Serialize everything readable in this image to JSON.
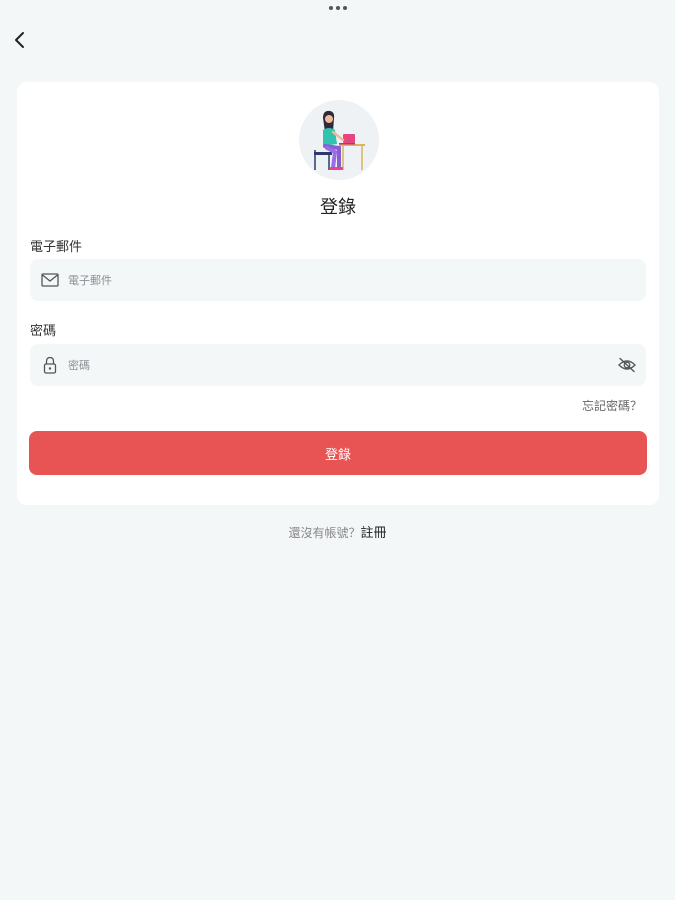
{
  "header": {
    "back_icon": "chevron-left-icon"
  },
  "login_card": {
    "title": "登錄",
    "avatar_icon": "person-at-desk-illustration",
    "email": {
      "label": "電子郵件",
      "placeholder": "電子郵件",
      "value": "",
      "icon": "mail-icon"
    },
    "password": {
      "label": "密碼",
      "placeholder": "密碼",
      "value": "",
      "icon": "lock-icon",
      "toggle_icon": "eye-off-icon"
    },
    "forgot_password": "忘記密碼？",
    "submit_label": "登錄"
  },
  "footer": {
    "prompt": "還沒有帳號？",
    "register_link": "註冊"
  },
  "colors": {
    "background": "#f4f7f8",
    "card": "#ffffff",
    "accent": "#e85454",
    "input_bg": "#f4f7f8"
  }
}
